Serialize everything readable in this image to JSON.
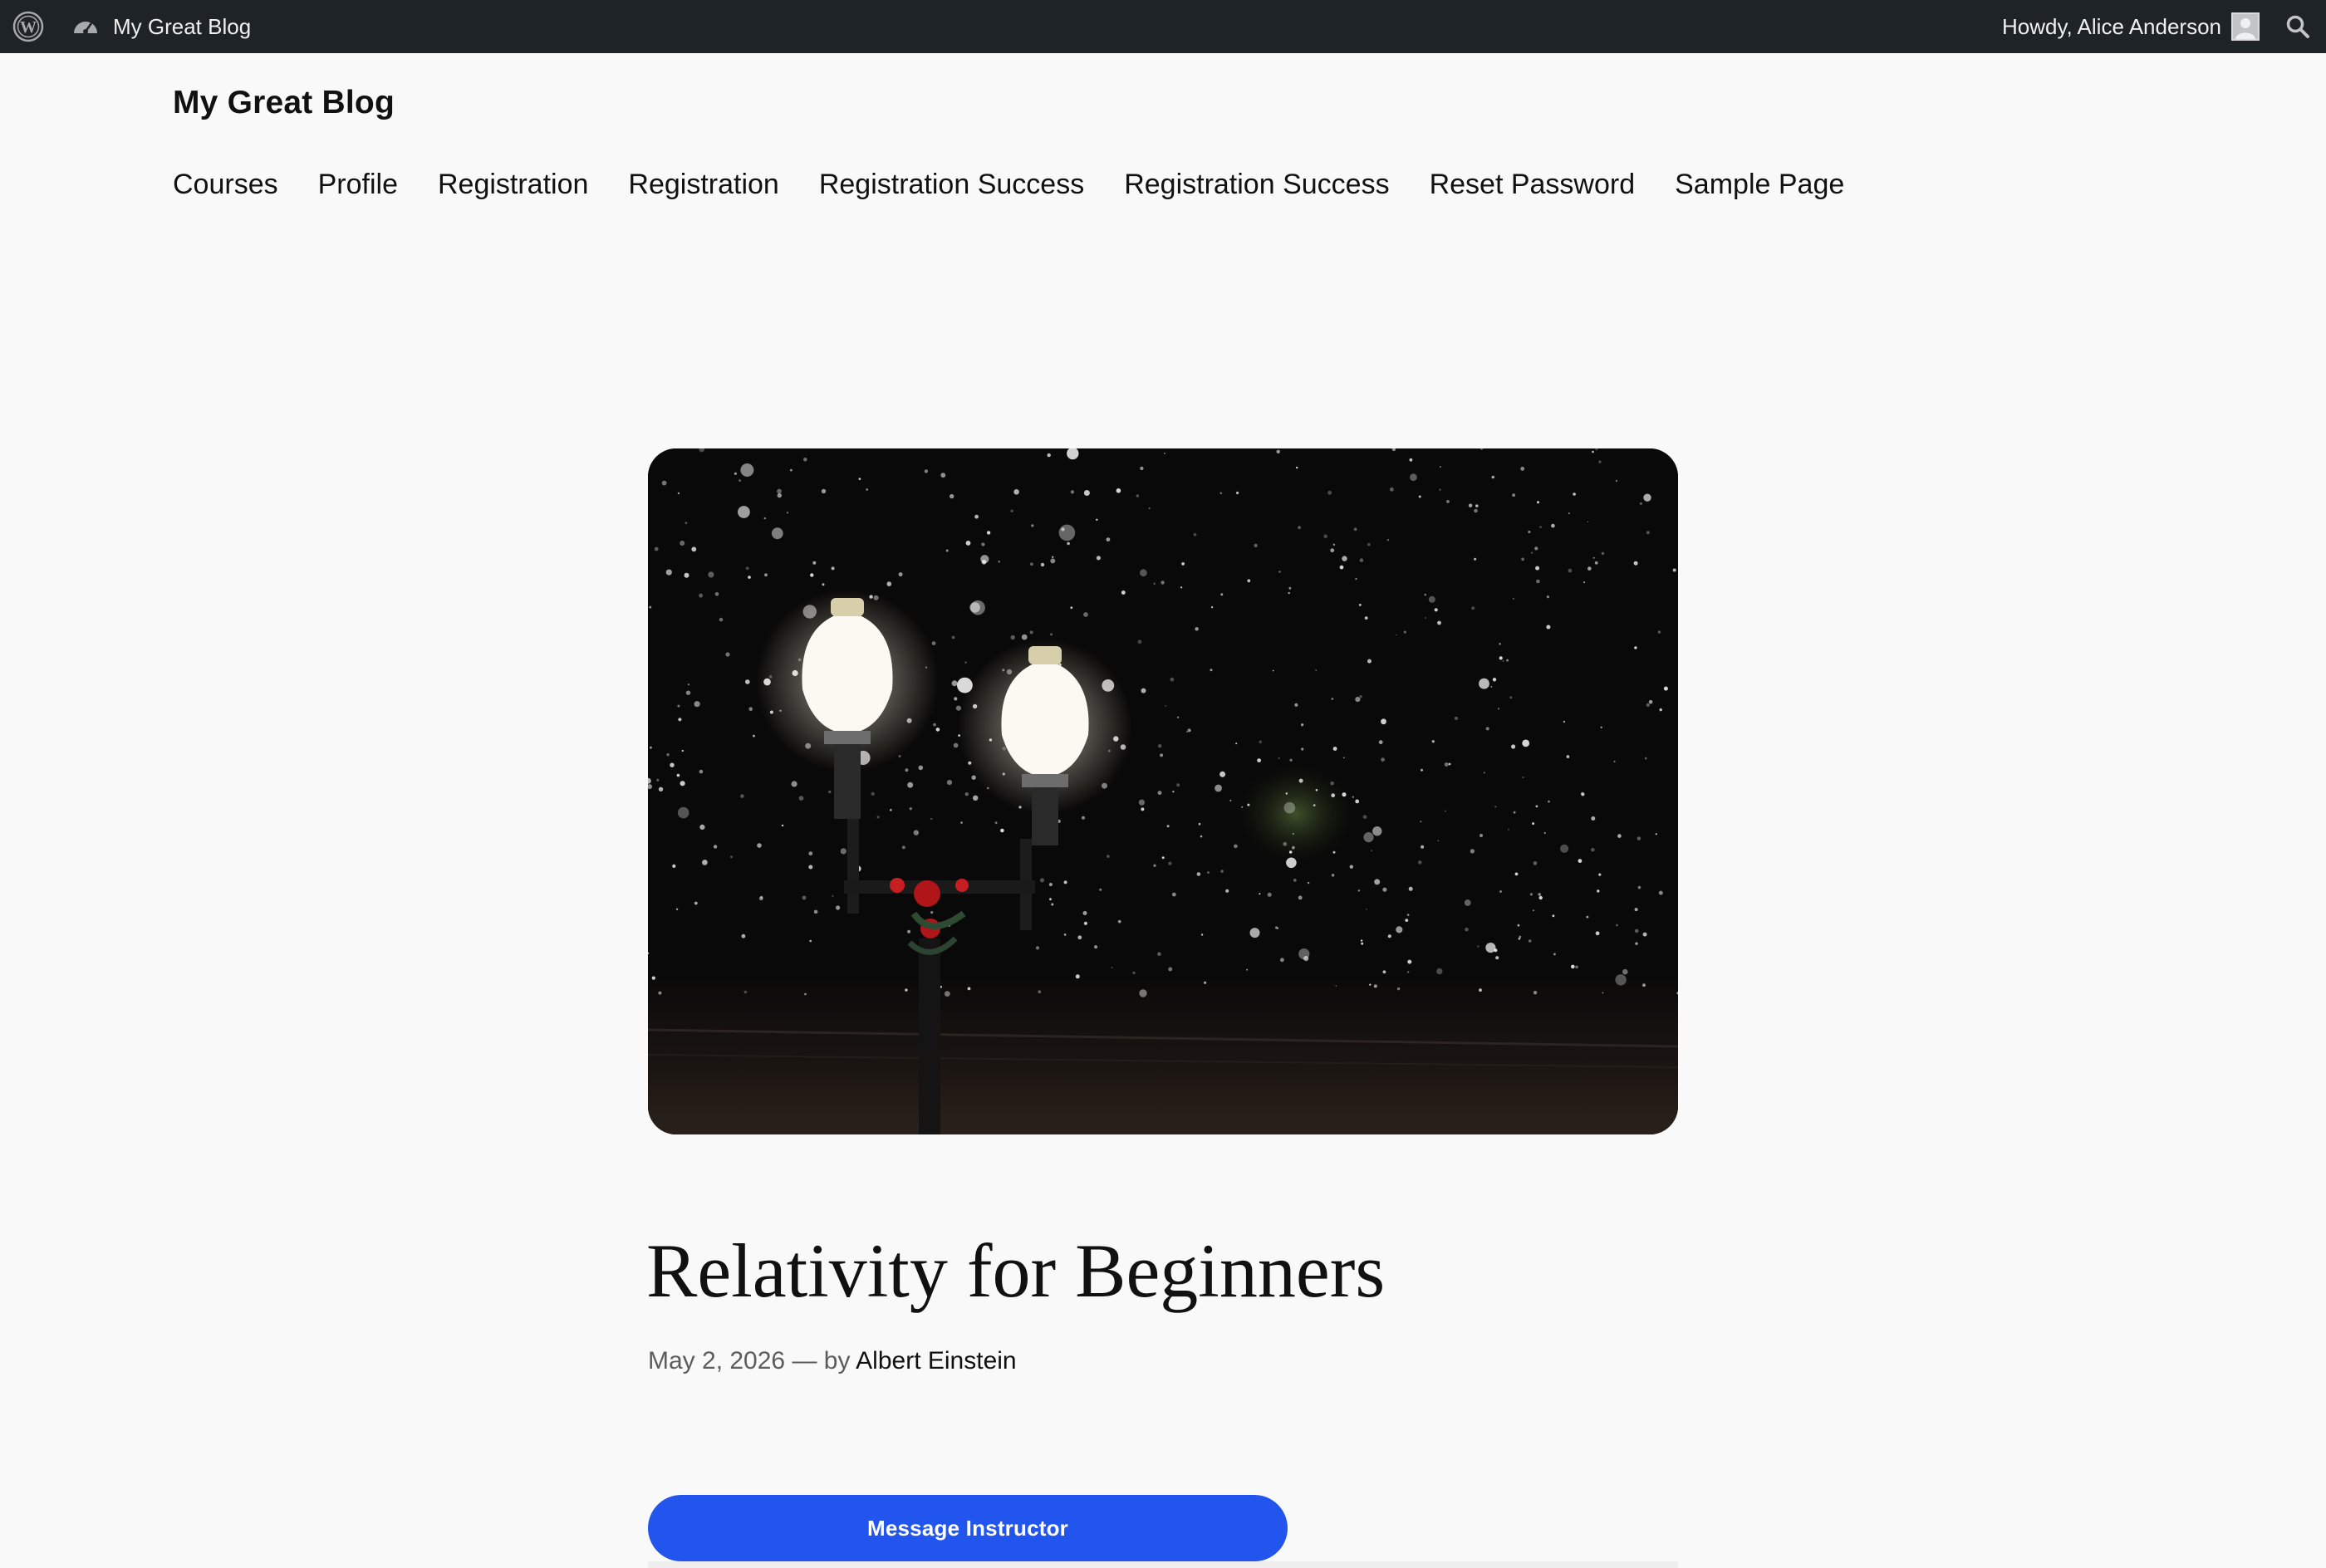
{
  "admin_bar": {
    "site_name": "My Great Blog",
    "howdy": "Howdy, Alice Anderson",
    "icons": [
      "wordpress-logo-icon",
      "dashboard-icon",
      "avatar",
      "search-icon"
    ],
    "background_color": "#1d2327"
  },
  "site": {
    "title": "My Great Blog"
  },
  "nav": {
    "items": [
      {
        "label": "Courses"
      },
      {
        "label": "Profile"
      },
      {
        "label": "Registration"
      },
      {
        "label": "Registration"
      },
      {
        "label": "Registration Success"
      },
      {
        "label": "Registration Success"
      },
      {
        "label": "Reset Password"
      },
      {
        "label": "Sample Page"
      }
    ]
  },
  "post": {
    "featured_image": "night-street-lamp-in-snow",
    "title": "Relativity for Beginners",
    "date": "May 2, 2026",
    "separator": "— by",
    "author": "Albert Einstein"
  },
  "actions": {
    "message_button": "Message Instructor",
    "button_color": "#2255ee"
  }
}
